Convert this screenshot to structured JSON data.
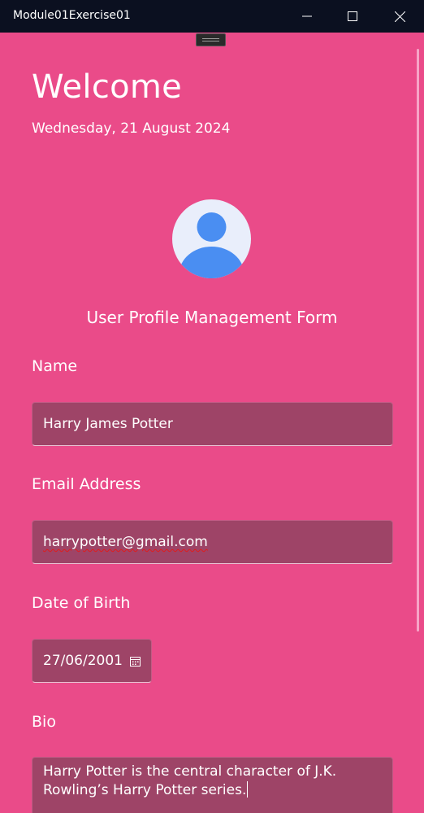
{
  "window": {
    "title": "Module01Exercise01",
    "minimize_icon": "minimize-icon",
    "maximize_icon": "maximize-icon",
    "close_icon": "close-icon"
  },
  "colors": {
    "background": "#ea4b89",
    "field": "#9e4467",
    "titlebar": "#0b1020",
    "avatar_bg": "#e9eefb",
    "avatar_fg": "#4a8ef2"
  },
  "header": {
    "welcome": "Welcome",
    "date": "Wednesday, 21 August 2024"
  },
  "profile": {
    "avatar_icon": "user-avatar-icon",
    "form_title": "User Profile Management Form"
  },
  "form": {
    "name_label": "Name",
    "name_value": "Harry James Potter",
    "email_label": "Email Address",
    "email_value": "harrypotter@gmail.com",
    "dob_label": "Date of Birth",
    "dob_value": "27/06/2001",
    "dob_icon": "calendar-icon",
    "bio_label": "Bio",
    "bio_value": "Harry Potter is the central character of J.K. Rowling’s Harry Potter series."
  }
}
